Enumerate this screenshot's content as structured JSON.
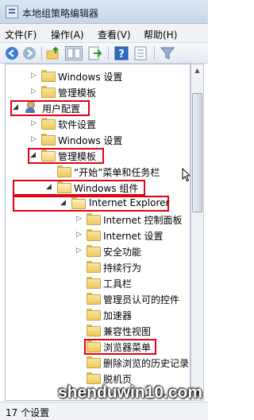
{
  "window": {
    "title": "本地组策略编辑器"
  },
  "menu": [
    "文件(F)",
    "操作(A)",
    "查看(V)",
    "帮助(H)"
  ],
  "toolbar": {
    "icons": [
      "back-arrow-icon",
      "forward-arrow-icon",
      "up-folder-icon",
      "show-hide-tree-icon",
      "export-list-icon",
      "help-icon",
      "properties-icon",
      "filter-icon"
    ]
  },
  "tree": {
    "rows": [
      {
        "label": "Windows 设置",
        "expanded": false,
        "icon": "folder"
      },
      {
        "label": "管理模板",
        "expanded": false,
        "icon": "folder"
      },
      {
        "label": "用户配置",
        "expanded": true,
        "icon": "user",
        "highlighted": true
      },
      {
        "label": "软件设置",
        "expanded": false,
        "icon": "folder"
      },
      {
        "label": "Windows 设置",
        "expanded": false,
        "icon": "folder"
      },
      {
        "label": "管理模板",
        "expanded": true,
        "icon": "folder",
        "highlighted": true
      },
      {
        "label": "“开始”菜单和任务栏",
        "expanded": null,
        "icon": "folder"
      },
      {
        "label": "Windows 组件",
        "expanded": true,
        "icon": "folder",
        "highlighted": true
      },
      {
        "label": "Internet Explorer",
        "expanded": true,
        "icon": "folder",
        "highlighted": true
      },
      {
        "label": "Internet 控制面板",
        "expanded": false,
        "icon": "folder"
      },
      {
        "label": "Internet 设置",
        "expanded": false,
        "icon": "folder"
      },
      {
        "label": "安全功能",
        "expanded": false,
        "icon": "folder"
      },
      {
        "label": "持续行为",
        "expanded": null,
        "icon": "folder"
      },
      {
        "label": "工具栏",
        "expanded": null,
        "icon": "folder"
      },
      {
        "label": "管理员认可的控件",
        "expanded": null,
        "icon": "folder"
      },
      {
        "label": "加速器",
        "expanded": null,
        "icon": "folder"
      },
      {
        "label": "兼容性视图",
        "expanded": null,
        "icon": "folder"
      },
      {
        "label": "浏览器菜单",
        "expanded": null,
        "icon": "folder",
        "highlighted": true
      },
      {
        "label": "删除浏览的历史记录",
        "expanded": null,
        "icon": "folder"
      },
      {
        "label": "脱机页",
        "expanded": null,
        "icon": "folder"
      }
    ]
  },
  "status": {
    "text": "17 个设置"
  },
  "watermark": {
    "text": "shenduwin10.com"
  },
  "colors": {
    "highlight": "#e60012",
    "folder": "#efc85a"
  }
}
